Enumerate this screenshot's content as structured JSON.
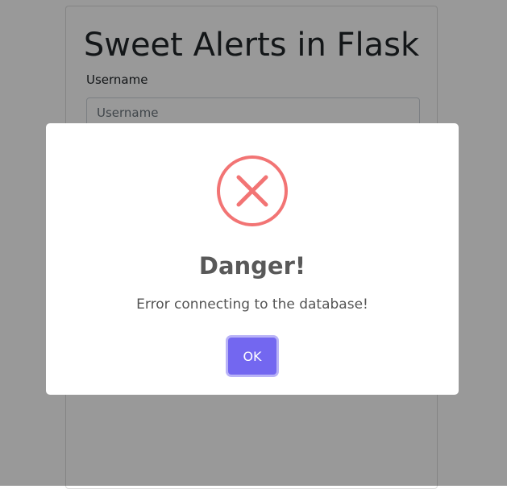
{
  "page": {
    "title": "Sweet Alerts in Flask",
    "username_label": "Username",
    "username_placeholder": "Username"
  },
  "modal": {
    "icon": "error-x-icon",
    "title": "Danger!",
    "text": "Error connecting to the database!",
    "ok_label": "OK"
  },
  "colors": {
    "error_icon": "#f27474",
    "ok_button": "#7367f0",
    "overlay": "rgba(0,0,0,0.4)"
  }
}
